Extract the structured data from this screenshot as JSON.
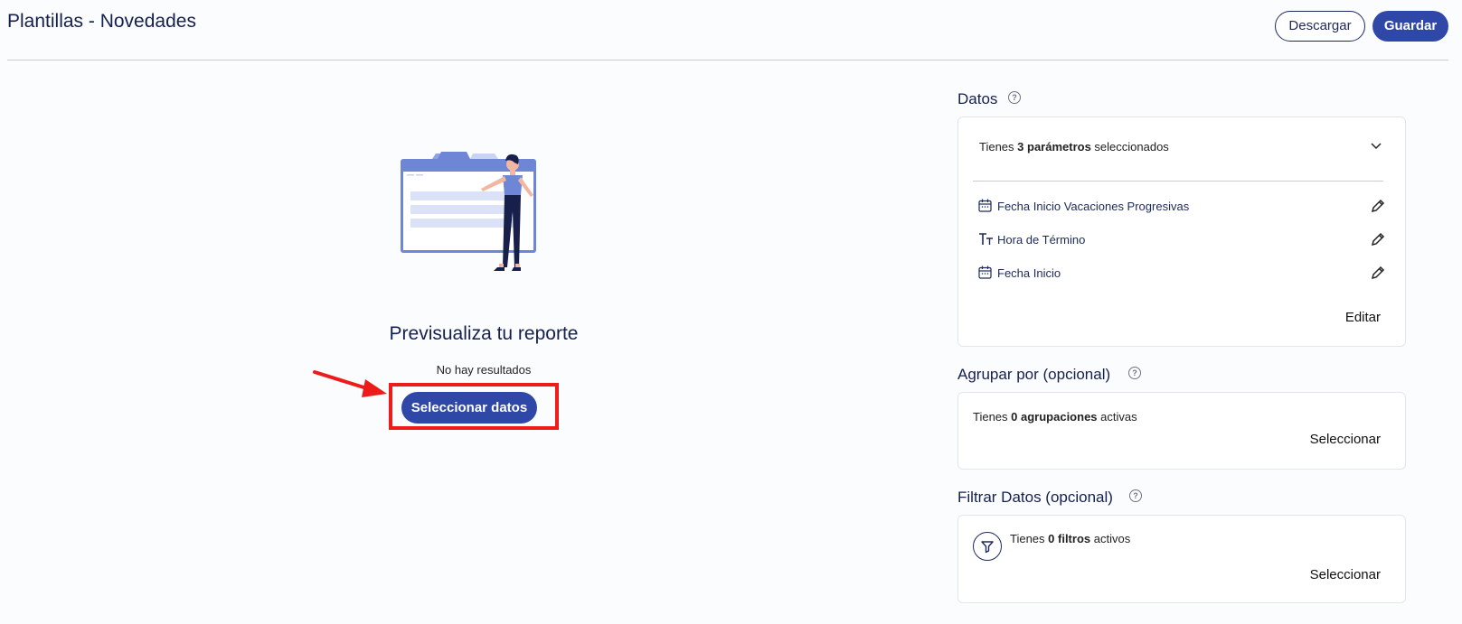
{
  "header": {
    "title": "Plantillas - Novedades",
    "download_label": "Descargar",
    "save_label": "Guardar"
  },
  "preview": {
    "title": "Previsualiza tu reporte",
    "empty_text": "No hay resultados",
    "select_button_label": "Seleccionar datos"
  },
  "datos": {
    "title": "Datos",
    "summary_prefix": "Tienes ",
    "summary_bold": "3 parámetros",
    "summary_suffix": " seleccionados",
    "params": [
      {
        "label": "Fecha Inicio Vacaciones Progresivas",
        "icon": "calendar-icon"
      },
      {
        "label": "Hora de Término",
        "icon": "text-type-icon"
      },
      {
        "label": "Fecha Inicio",
        "icon": "calendar-icon"
      }
    ],
    "edit_label": "Editar"
  },
  "agrupar": {
    "title": "Agrupar por (opcional)",
    "summary_prefix": "Tienes ",
    "summary_bold": "0 agrupaciones",
    "summary_suffix": " activas",
    "action_label": "Seleccionar"
  },
  "filtrar": {
    "title": "Filtrar Datos (opcional)",
    "summary_prefix": "Tienes ",
    "summary_bold": "0 filtros",
    "summary_suffix": " activos",
    "action_label": "Seleccionar"
  },
  "colors": {
    "primary": "#2f48a8",
    "title_text": "#16204f",
    "highlight": "#ee1b1b",
    "illustration_accent": "#6f86d6"
  }
}
